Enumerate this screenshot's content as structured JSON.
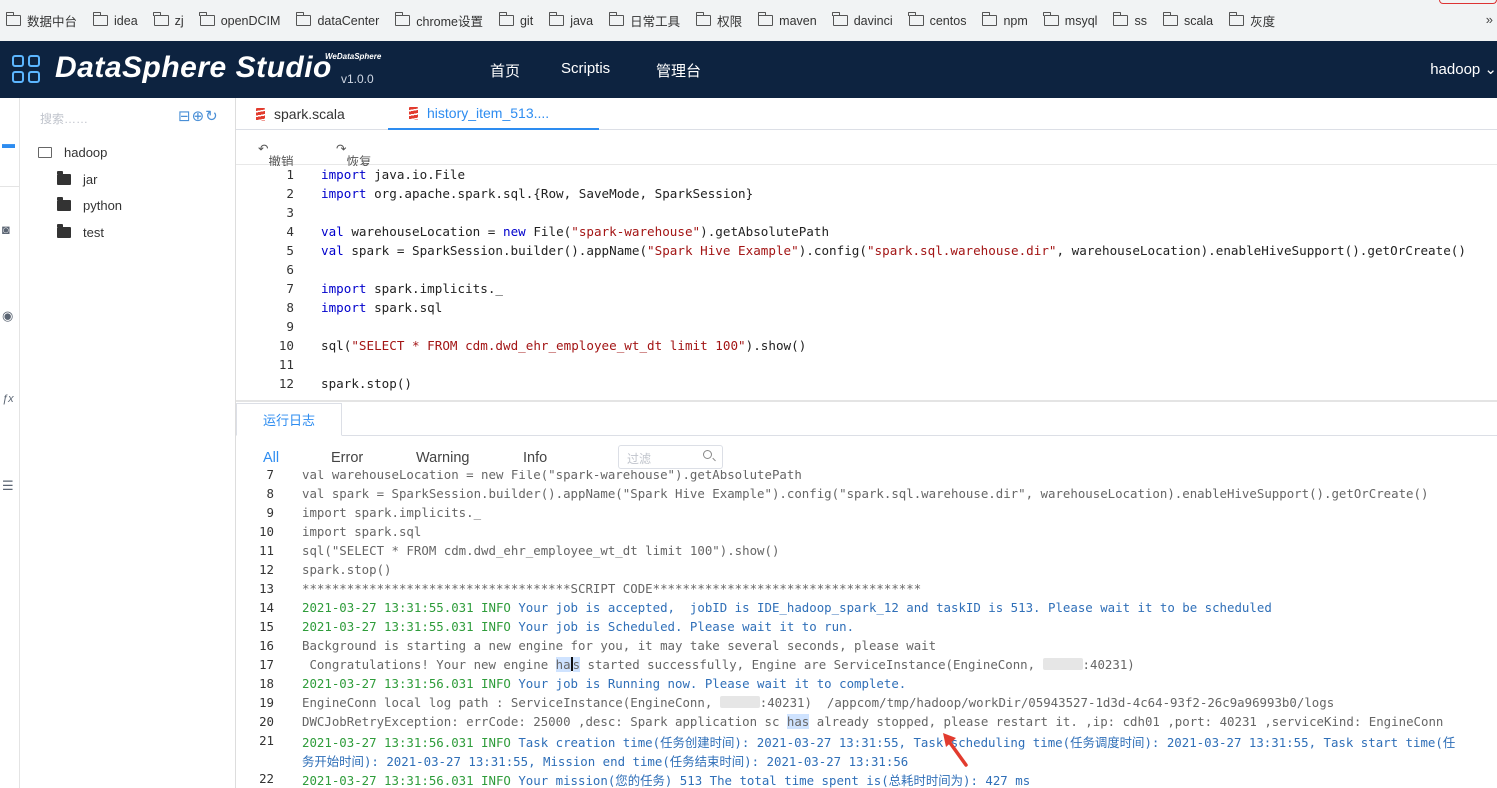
{
  "bookmarks": [
    "数据中台",
    "idea",
    "zj",
    "openDCIM",
    "dataCenter",
    "chrome设置",
    "git",
    "java",
    "日常工具",
    "权限",
    "maven",
    "davinci",
    "centos",
    "npm",
    "msyql",
    "ss",
    "scala",
    "灰度"
  ],
  "bookmarks_more": "»",
  "app": {
    "logo": "DataSphere Studio",
    "logo_small": "WeDataSphere",
    "version": "v1.0.0",
    "nav": [
      "首页",
      "Scriptis",
      "管理台"
    ],
    "user": "hadoop ⌄"
  },
  "rail_icons": [
    "folder-icon",
    "database-icon",
    "target-icon",
    "function-icon",
    "list-icon"
  ],
  "tree": {
    "search_placeholder": "搜索……",
    "tools": "⊟⊕↻",
    "root": "hadoop",
    "children": [
      "jar",
      "python",
      "test"
    ]
  },
  "tabs": [
    "spark.scala",
    "history_item_513...."
  ],
  "toolbar": {
    "undo": "撤销",
    "redo": "恢复"
  },
  "editor": {
    "lines": [
      {
        "n": "1",
        "html": "<span class='kw'>import</span> java.io.File"
      },
      {
        "n": "2",
        "html": "<span class='kw'>import</span> org.apache.spark.sql.{Row, SaveMode, SparkSession}"
      },
      {
        "n": "3",
        "html": ""
      },
      {
        "n": "4",
        "html": "<span class='kw'>val</span> warehouseLocation = <span class='kw'>new</span> File(<span class='str'>\"spark-warehouse\"</span>).getAbsolutePath"
      },
      {
        "n": "5",
        "html": "<span class='kw'>val</span> spark = SparkSession.builder().appName(<span class='str'>\"Spark Hive Example\"</span>).config(<span class='str'>\"spark.sql.warehouse.dir\"</span>, warehouseLocation).enableHiveSupport().getOrCreate()"
      },
      {
        "n": "6",
        "html": ""
      },
      {
        "n": "7",
        "html": "<span class='kw'>import</span> spark.implicits._"
      },
      {
        "n": "8",
        "html": "<span class='kw'>import</span> spark.sql"
      },
      {
        "n": "9",
        "html": ""
      },
      {
        "n": "10",
        "html": "sql(<span class='str'>\"SELECT * FROM cdm.dwd_ehr_employee_wt_dt limit 100\"</span>).show()"
      },
      {
        "n": "11",
        "html": ""
      },
      {
        "n": "12",
        "html": "spark.stop()"
      }
    ]
  },
  "log_tab": "运行日志",
  "filters": {
    "all": "All",
    "error": "Error",
    "warning": "Warning",
    "info": "Info",
    "placeholder": "过滤"
  },
  "log": [
    {
      "n": "7",
      "cls": "c-gray",
      "html": "val warehouseLocation = new File(\"spark-warehouse\").getAbsolutePath"
    },
    {
      "n": "8",
      "cls": "c-gray",
      "html": "val spark = SparkSession.builder().appName(\"Spark Hive Example\").config(\"spark.sql.warehouse.dir\", warehouseLocation).enableHiveSupport().getOrCreate()"
    },
    {
      "n": "9",
      "cls": "c-gray",
      "html": "import spark.implicits._"
    },
    {
      "n": "10",
      "cls": "c-gray",
      "html": "import spark.sql"
    },
    {
      "n": "11",
      "cls": "c-gray",
      "html": "sql(\"SELECT * FROM cdm.dwd_ehr_employee_wt_dt limit 100\").show()"
    },
    {
      "n": "12",
      "cls": "c-gray",
      "html": "spark.stop()"
    },
    {
      "n": "13",
      "cls": "c-gray",
      "html": "************************************SCRIPT CODE************************************"
    },
    {
      "n": "14",
      "cls": "c-blue",
      "html": "<span class='c-green'>2021-03-27 13:31:55.031 INFO</span> Your job is accepted,  jobID is IDE_hadoop_spark_12 and taskID is 513. Please wait it to be scheduled"
    },
    {
      "n": "15",
      "cls": "c-blue",
      "html": "<span class='c-green'>2021-03-27 13:31:55.031 INFO</span> Your job is Scheduled. Please wait it to run."
    },
    {
      "n": "16",
      "cls": "c-gray",
      "html": "Background is starting a new engine for you, it may take several seconds, please wait"
    },
    {
      "n": "17",
      "cls": "c-gray",
      "html": " Congratulations! Your new engine <span class='sel'>ha</span><span class='cursor'></span><span class='sel'>s</span> started successfully, Engine are ServiceInstance(EngineConn, <span class='blur'></span>:40231)"
    },
    {
      "n": "18",
      "cls": "c-blue",
      "html": "<span class='c-green'>2021-03-27 13:31:56.031 INFO</span> Your job is Running now. Please wait it to complete."
    },
    {
      "n": "19",
      "cls": "c-gray",
      "html": "EngineConn local log path : ServiceInstance(EngineConn, <span class='blur'></span>:40231)  /appcom/tmp/hadoop/workDir/05943527-1d3d-4c64-93f2-26c9a96993b0/logs"
    },
    {
      "n": "20",
      "cls": "c-gray",
      "html": "DWCJobRetryException: errCode: 25000 ,desc: Spark application sc <span class='sel'>has</span> already stopped, please restart it. ,ip: cdh01 ,port: 40231 ,serviceKind: EngineConn"
    },
    {
      "n": "21",
      "cls": "c-blue",
      "html": "<span class='c-green'>2021-03-27 13:31:56.031 INFO</span> Task creation time(任务创建时间): 2021-03-27 13:31:55, Task scheduling time(任务调度时间): 2021-03-27 13:31:55, Task start time(任"
    },
    {
      "n": "",
      "cls": "c-blue",
      "html": "务开始时间): 2021-03-27 13:31:55, Mission end time(任务结束时间): 2021-03-27 13:31:56"
    },
    {
      "n": "22",
      "cls": "c-blue",
      "html": "<span class='c-green'>2021-03-27 13:31:56.031 INFO</span> Your mission(您的任务) 513 The total time spent is(总耗时时间为): 427 ms"
    }
  ]
}
